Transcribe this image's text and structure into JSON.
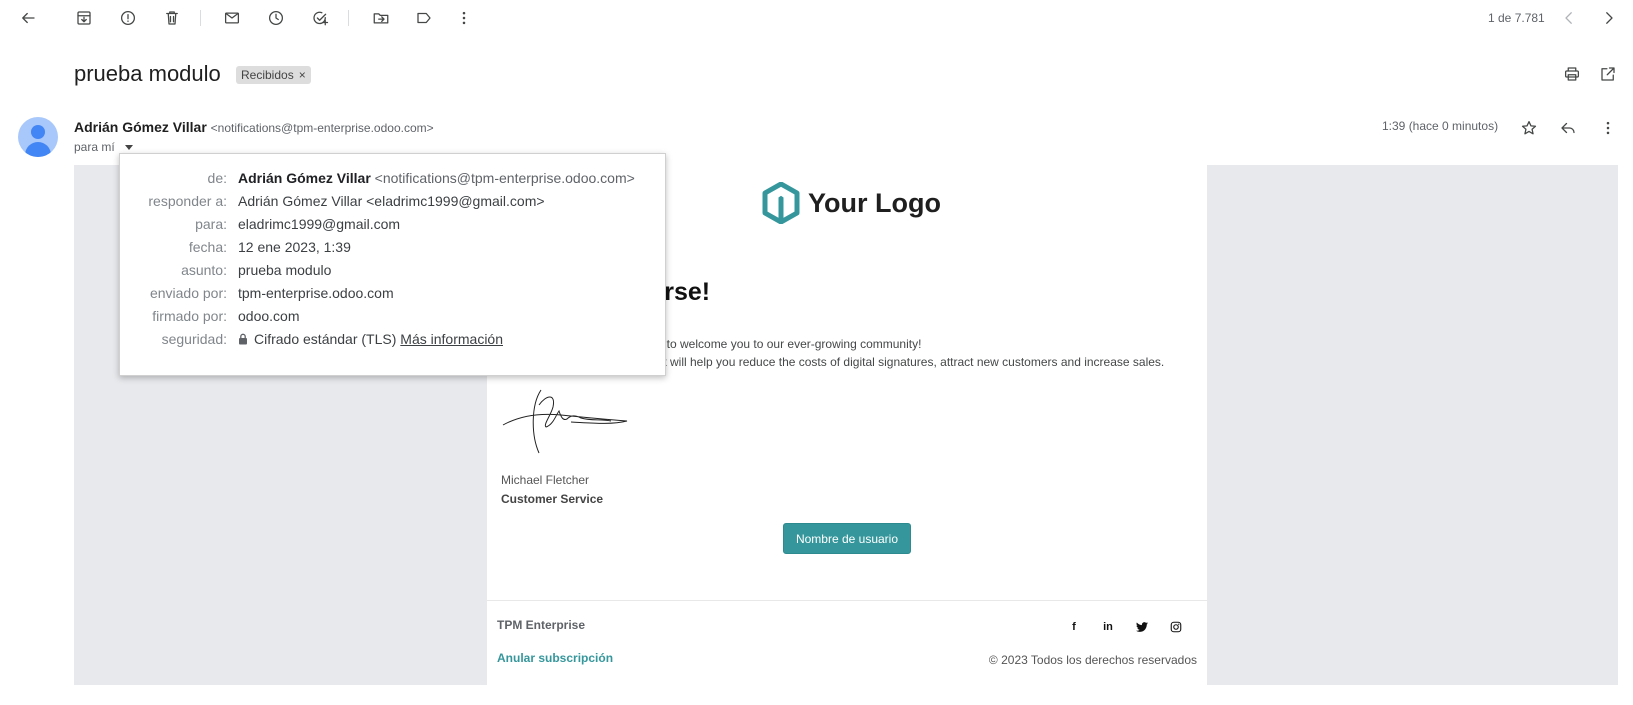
{
  "toolbar": {
    "pager": "1 de 7.781",
    "icons": [
      "back-arrow-icon",
      "archive-icon",
      "report-spam-icon",
      "delete-icon",
      "mark-unread-icon",
      "snooze-icon",
      "add-task-icon",
      "move-to-icon",
      "label-icon",
      "more-vert-icon",
      "prev-icon",
      "next-icon"
    ]
  },
  "message": {
    "subject": "prueba modulo",
    "label": "Recibidos",
    "label_remove": "×",
    "sender_name": "Adrián Gómez Villar",
    "sender_email": "<notifications@tpm-enterprise.odoo.com>",
    "to_me": "para mí",
    "time": "1:39 (hace 0 minutos)"
  },
  "details": {
    "rows": [
      {
        "key": "de:",
        "name": "Adrián Gómez Villar",
        "value": "<notifications@tpm-enterprise.odoo.com>"
      },
      {
        "key": "responder a:",
        "value": "Adrián Gómez Villar <eladrimc1999@gmail.com>"
      },
      {
        "key": "para:",
        "value": "eladrimc1999@gmail.com"
      },
      {
        "key": "fecha:",
        "value": "12 ene 2023, 1:39"
      },
      {
        "key": "asunto:",
        "value": "prueba modulo"
      },
      {
        "key": "enviado por:",
        "value": "tpm-enterprise.odoo.com"
      },
      {
        "key": "firmado por:",
        "value": "odoo.com"
      },
      {
        "key": "seguridad:",
        "value": "Cifrado estándar (TLS)",
        "link": "Más información"
      }
    ]
  },
  "email": {
    "logo_text": "Your Logo",
    "heading": "nirse!",
    "p1": "ty to welcome you to our ever-growing community!",
    "p2": ", it will help you reduce the costs of digital signatures, attract new customers and increase sales.",
    "sig_name": "Michael Fletcher",
    "sig_role": "Customer Service",
    "cta": "Nombre de usuario",
    "company": "TPM Enterprise",
    "unsubscribe": "Anular subscripción",
    "copyright": "© 2023 Todos los derechos reservados",
    "socials": [
      "facebook-icon",
      "linkedin-icon",
      "twitter-icon",
      "instagram-icon"
    ],
    "brand_color": "#35979c"
  }
}
